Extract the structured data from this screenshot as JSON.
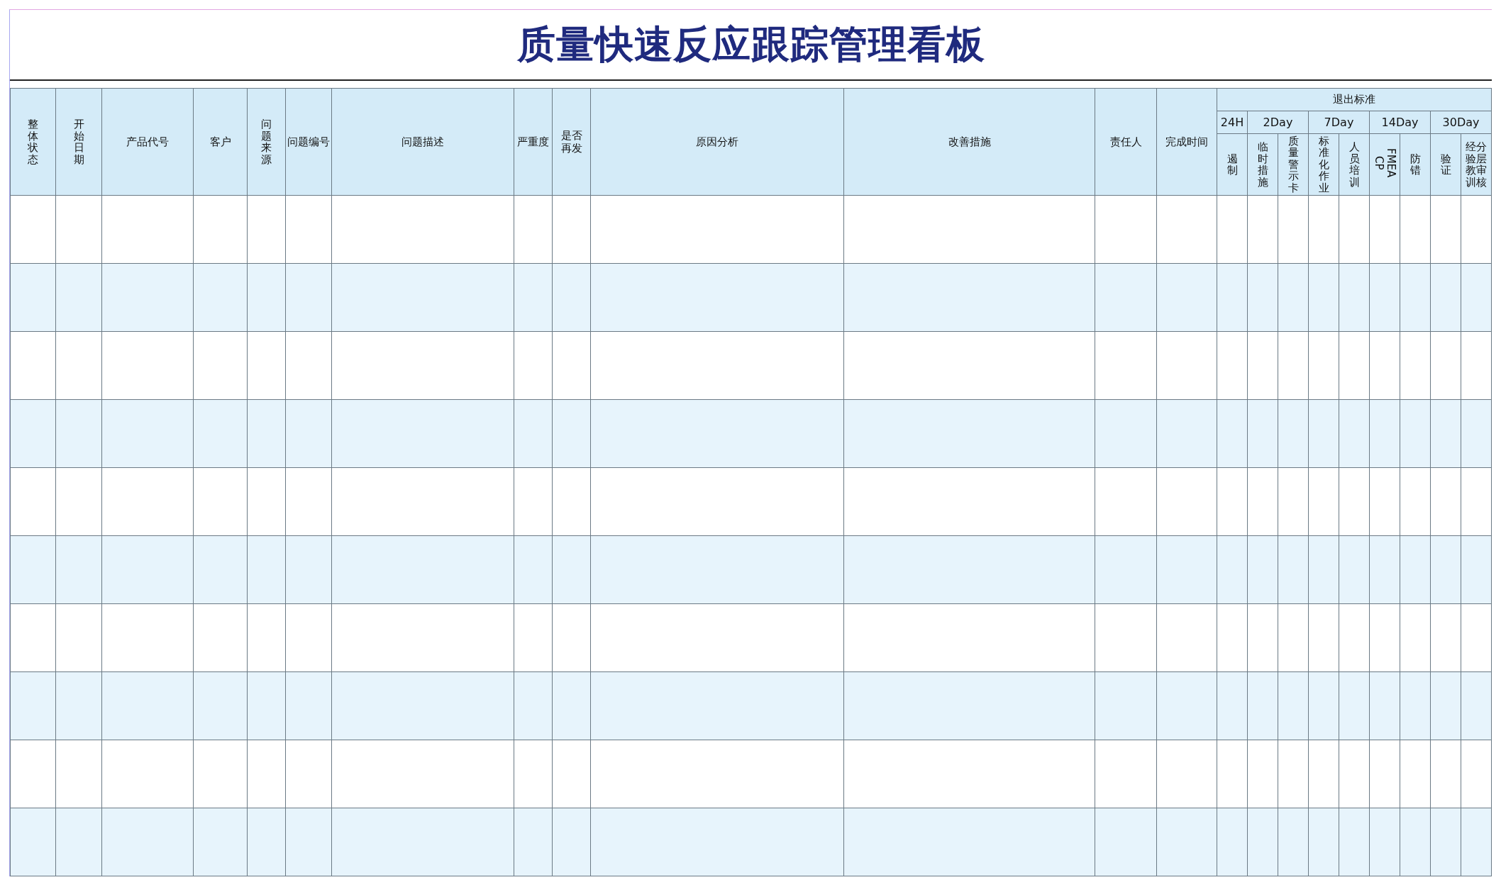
{
  "title": "质量快速反应跟踪管理看板",
  "columns": [
    {
      "kind": "stacked",
      "lines": [
        "整体状态"
      ]
    },
    {
      "kind": "stacked",
      "lines": [
        "开始日期"
      ]
    },
    {
      "kind": "flat",
      "lines": [
        "产品代号"
      ]
    },
    {
      "kind": "flat",
      "lines": [
        "客户"
      ]
    },
    {
      "kind": "stacked",
      "lines": [
        "问题来源"
      ]
    },
    {
      "kind": "flat",
      "lines": [
        "问题编号"
      ]
    },
    {
      "kind": "flat",
      "lines": [
        "问题描述"
      ]
    },
    {
      "kind": "flat",
      "lines": [
        "严重度"
      ]
    },
    {
      "kind": "flat",
      "lines": [
        "是否",
        "再发"
      ]
    },
    {
      "kind": "flat",
      "lines": [
        "原因分析"
      ]
    },
    {
      "kind": "flat",
      "lines": [
        "改善措施"
      ]
    },
    {
      "kind": "flat",
      "lines": [
        "责任人"
      ]
    },
    {
      "kind": "flat",
      "lines": [
        "完成时间"
      ]
    }
  ],
  "exit_criteria": {
    "label": "退出标准",
    "groups": [
      {
        "label": "24H",
        "items": [
          {
            "kind": "stacked",
            "lines": [
              "遏制"
            ]
          }
        ]
      },
      {
        "label": "2Day",
        "items": [
          {
            "kind": "stacked",
            "lines": [
              "临时措施"
            ]
          },
          {
            "kind": "stacked",
            "lines": [
              "质量警示卡"
            ]
          }
        ]
      },
      {
        "label": "7Day",
        "items": [
          {
            "kind": "stacked",
            "lines": [
              "标准化作业"
            ]
          },
          {
            "kind": "stacked",
            "lines": [
              "人员培训"
            ]
          }
        ]
      },
      {
        "label": "14Day",
        "items": [
          {
            "kind": "rotated",
            "lines": [
              "FMEA",
              "CP"
            ]
          },
          {
            "kind": "stacked",
            "lines": [
              "防错"
            ]
          }
        ]
      },
      {
        "label": "30Day",
        "items": [
          {
            "kind": "stacked",
            "lines": [
              "验证"
            ]
          },
          {
            "kind": "stacked",
            "lines": [
              "经验教训",
              "分层审核"
            ]
          }
        ]
      }
    ]
  },
  "rows": [
    {
      "kind": "plain"
    },
    {
      "kind": "shaded"
    },
    {
      "kind": "plain"
    },
    {
      "kind": "shaded"
    },
    {
      "kind": "plain"
    },
    {
      "kind": "shaded"
    },
    {
      "kind": "plain"
    },
    {
      "kind": "shaded"
    },
    {
      "kind": "plain"
    },
    {
      "kind": "shaded"
    }
  ]
}
